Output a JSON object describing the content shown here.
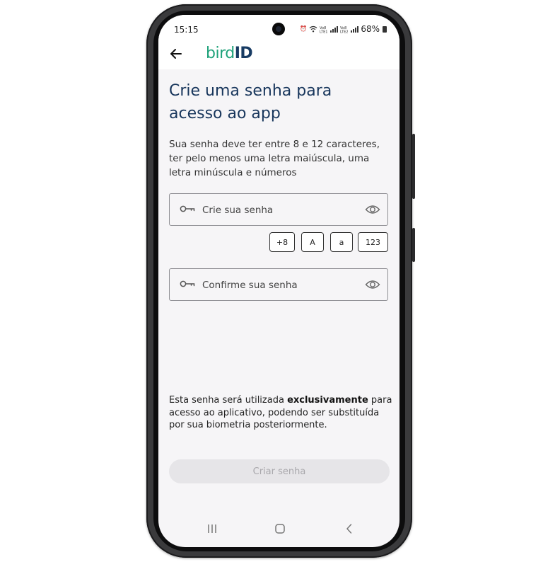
{
  "status_bar": {
    "time": "15:15",
    "signal_1_label": "Vo8 LTE1",
    "signal_2_label": "Vo8 LTE2",
    "battery": "68%"
  },
  "app_bar": {
    "logo_bird": "bird",
    "logo_id": "ID",
    "back_icon": "arrow-left-icon"
  },
  "page": {
    "title_line1": "Crie uma senha para",
    "title_line2": "acesso ao app",
    "subtitle_line1": "Sua senha deve ter entre 8 e 12 caracteres,",
    "subtitle_line2": "ter pelo menos uma letra maiúscula, uma",
    "subtitle_line3": "letra minúscula e números"
  },
  "password_field": {
    "placeholder": "Crie sua senha",
    "value": "",
    "icon": "key-icon",
    "toggle_icon": "eye-icon"
  },
  "rules": [
    {
      "label": "+8"
    },
    {
      "label": "A"
    },
    {
      "label": "a"
    },
    {
      "label": "123"
    }
  ],
  "confirm_field": {
    "placeholder": "Confirme sua senha",
    "value": "",
    "icon": "key-icon",
    "toggle_icon": "eye-icon"
  },
  "note": {
    "part1": "Esta senha será utilizada ",
    "bold": "exclusivamente",
    "part2": " para",
    "line2": "acesso ao aplicativo, podendo ser substituída",
    "line3": "por sua biometria posteriormente."
  },
  "cta": {
    "label": "Criar senha",
    "state": "disabled"
  },
  "colors": {
    "brand_green": "#1fa27a",
    "brand_navy": "#173b63",
    "button_disabled_bg": "#e6e5e8",
    "button_disabled_text": "#a9a8ac"
  }
}
